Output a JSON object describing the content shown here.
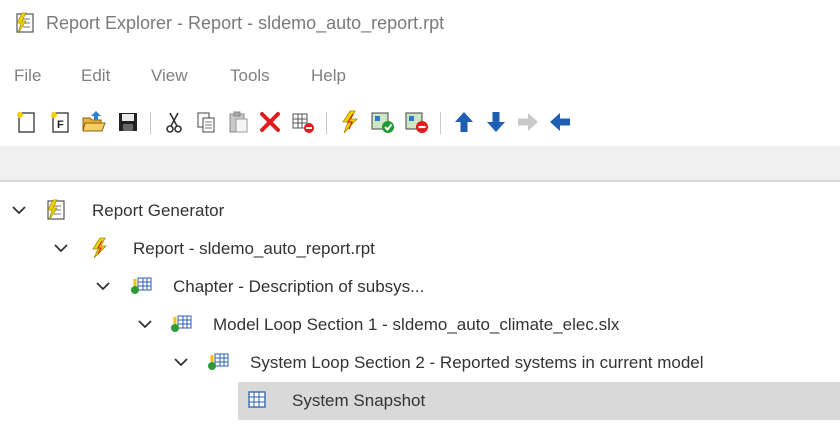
{
  "window": {
    "title": "Report Explorer - Report - sldemo_auto_report.rpt",
    "icon": "report-explorer-icon"
  },
  "menu": [
    {
      "label": "File"
    },
    {
      "label": "Edit"
    },
    {
      "label": "View"
    },
    {
      "label": "Tools"
    },
    {
      "label": "Help"
    }
  ],
  "toolbar": [
    {
      "icon": "new-report-icon"
    },
    {
      "icon": "new-form-icon"
    },
    {
      "icon": "open-icon"
    },
    {
      "icon": "save-icon"
    },
    {
      "icon": "cut-icon"
    },
    {
      "icon": "copy-icon"
    },
    {
      "icon": "paste-icon"
    },
    {
      "icon": "delete-icon"
    },
    {
      "icon": "deactivate-component-icon"
    },
    {
      "icon": "generate-report-icon"
    },
    {
      "icon": "activate-icon"
    },
    {
      "icon": "deactivate-icon"
    },
    {
      "icon": "move-up-icon"
    },
    {
      "icon": "move-down-icon"
    },
    {
      "icon": "demote-icon"
    },
    {
      "icon": "promote-icon"
    }
  ],
  "tree": [
    {
      "label": "Report Generator",
      "expanded": true,
      "icon": "report-generator-icon"
    },
    {
      "label": "Report - sldemo_auto_report.rpt",
      "expanded": true,
      "icon": "report-lightning-icon"
    },
    {
      "label": "Chapter - Description of subsys...",
      "expanded": true,
      "icon": "chapter-icon"
    },
    {
      "label": "Model Loop Section 1 - sldemo_auto_climate_elec.slx",
      "expanded": true,
      "icon": "model-loop-icon"
    },
    {
      "label": "System Loop Section 2 - Reported systems in current model",
      "expanded": true,
      "icon": "system-loop-icon"
    },
    {
      "label": "System Snapshot",
      "selected": true,
      "icon": "system-snapshot-icon"
    }
  ],
  "colors": {
    "selection": "#d9d9d9",
    "arrow_blue": "#1e5fb3",
    "delete_red": "#e01b1b",
    "lightning": "#e8c400"
  }
}
